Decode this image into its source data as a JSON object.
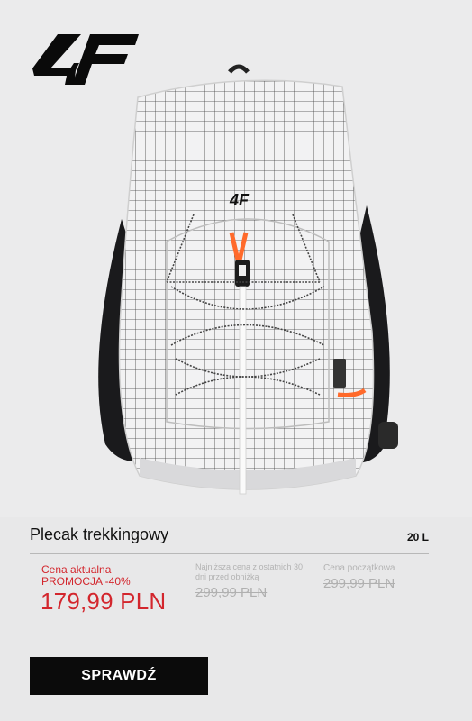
{
  "brand": {
    "logo_text": "4F"
  },
  "product": {
    "title": "Plecak trekkingowy",
    "capacity": "20 L",
    "image_icon": "backpack-image"
  },
  "pricing": {
    "current_label": "Cena aktualna",
    "promo_label": "PROMOCJA -40%",
    "current_price": "179,99 PLN",
    "lowest_label": "Najniższa cena z ostatnich 30 dni przed obniżką",
    "lowest_price": "299,99 PLN",
    "initial_label": "Cena początkowa",
    "initial_price": "299,99 PLN"
  },
  "cta": {
    "label": "SPRAWDŹ"
  },
  "colors": {
    "accent_red": "#d3262d",
    "button_bg": "#0b0b0b",
    "background": "#e8e8e9"
  }
}
